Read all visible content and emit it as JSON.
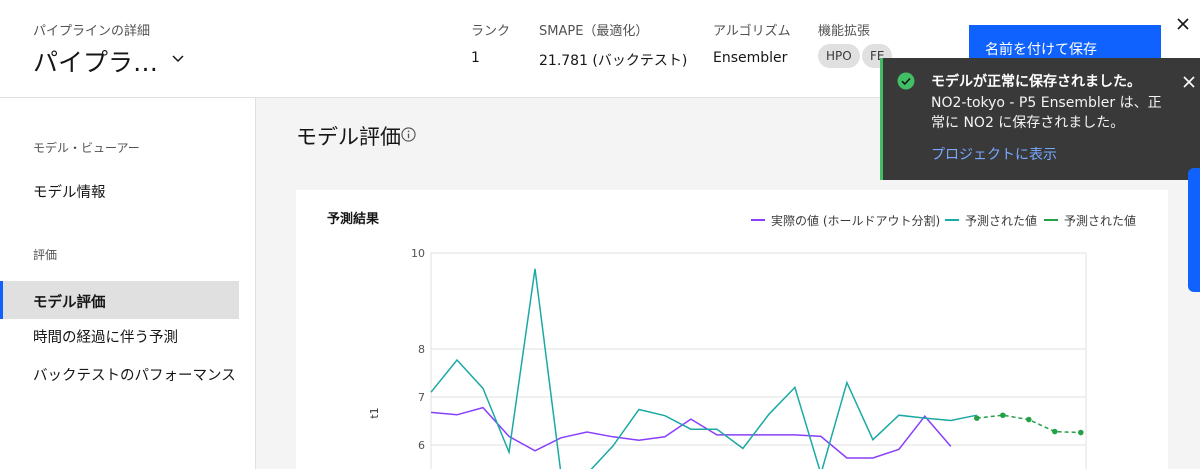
{
  "header": {
    "subtitle": "パイプラインの詳細",
    "title": "パイプラ…",
    "rank_label": "ランク",
    "rank_value": "1",
    "smape_label": "SMAPE（最適化）",
    "smape_value": "21.781 (バックテスト)",
    "algorithm_label": "アルゴリズム",
    "algorithm_value": "Ensembler",
    "features_label": "機能拡張",
    "tags": [
      "HPO",
      "FE"
    ],
    "save_label": "名前を付けて保存"
  },
  "sidebar": {
    "section1": "モデル・ビューアー",
    "item_model_info": "モデル情報",
    "section2": "評価",
    "item_model_eval": "モデル評価",
    "item_forecast": "時間の経過に伴う予測",
    "item_backtest": "バックテストのパフォーマンス"
  },
  "main": {
    "title": "モデル評価"
  },
  "chart_data": {
    "type": "line",
    "title": "予測結果",
    "ylabel": "t1",
    "ylim": [
      5.5,
      10
    ],
    "yticks": [
      6,
      7,
      8,
      10
    ],
    "series": [
      {
        "name": "実際の値 (ホールドアウト分割)",
        "color": "#8a3ffc",
        "x": [
          0,
          1,
          2,
          3,
          4,
          5,
          6,
          7,
          8,
          9,
          10,
          11,
          12,
          13,
          14,
          15,
          16,
          17,
          18,
          19,
          20
        ],
        "values": [
          6.68,
          6.63,
          6.78,
          6.18,
          5.88,
          6.15,
          6.27,
          6.17,
          6.1,
          6.17,
          6.54,
          6.21,
          6.21,
          6.21,
          6.21,
          6.18,
          5.73,
          5.73,
          5.91,
          6.6,
          5.97
        ]
      },
      {
        "name": "予測された値",
        "color": "#1ba9a4",
        "x": [
          0,
          1,
          2,
          3,
          4,
          5,
          6,
          7,
          8,
          9,
          10,
          11,
          12,
          13,
          14,
          15,
          16,
          17,
          18,
          19,
          20,
          21
        ],
        "values": [
          7.1,
          7.77,
          7.18,
          5.85,
          9.67,
          5.4,
          5.4,
          5.98,
          6.74,
          6.61,
          6.33,
          6.33,
          5.93,
          6.64,
          7.2,
          5.4,
          7.3,
          6.11,
          6.62,
          6.56,
          6.51,
          6.62
        ]
      },
      {
        "name": "予測された値",
        "color": "#24a148",
        "dashed": true,
        "x": [
          21,
          22,
          23,
          24,
          25
        ],
        "values": [
          6.56,
          6.62,
          6.53,
          6.28,
          6.26
        ]
      }
    ]
  },
  "toast": {
    "title": "モデルが正常に保存されました。",
    "body": "NO2-tokyo - P5 Ensembler は、正常に NO2 に保存されました。",
    "link": "プロジェクトに表示"
  },
  "colors": {
    "accent": "#0f62fe",
    "success": "#42be65",
    "toast_bg": "#393939"
  }
}
